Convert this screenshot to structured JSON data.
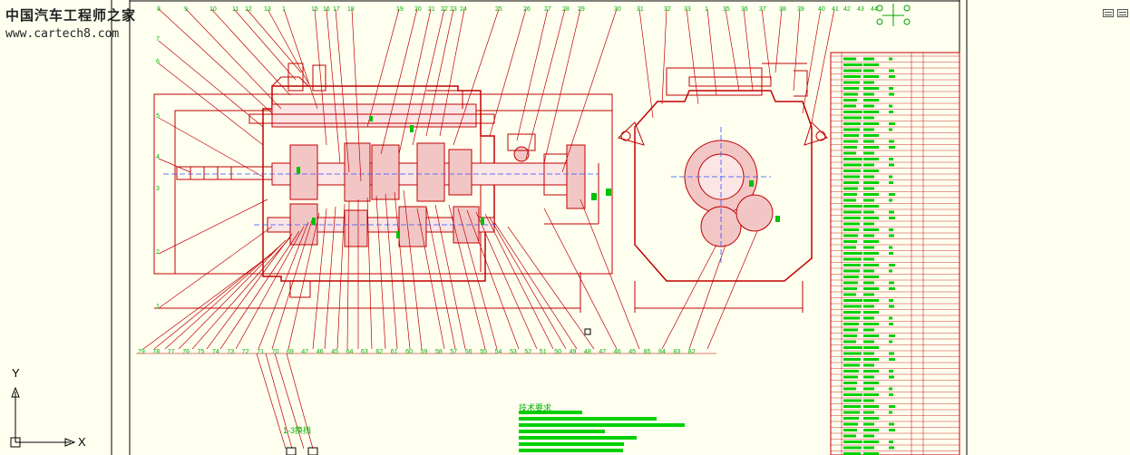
{
  "watermark": {
    "title": "中国汽车工程师之家",
    "url": "www.cartech8.com"
  },
  "axes": {
    "y": "Y",
    "x": "X"
  },
  "notes": {
    "subassembly": "1-3换挡",
    "tech_req": "技术要求"
  },
  "callouts_top": [
    "8",
    "9",
    "10",
    "11",
    "12",
    "13",
    "1",
    "15",
    "16",
    "17",
    "18",
    "19",
    "20",
    "21",
    "22",
    "23",
    "24",
    "25",
    "26",
    "27",
    "28",
    "29",
    "30",
    "31",
    "32",
    "33",
    "1",
    "35",
    "36",
    "37",
    "38",
    "39",
    "40",
    "41",
    "42",
    "43",
    "44"
  ],
  "callouts_bottom": [
    "79",
    "78",
    "77",
    "76",
    "75",
    "74",
    "73",
    "72",
    "71",
    "70",
    "69",
    "47",
    "46",
    "45",
    "64",
    "63",
    "62",
    "61",
    "60",
    "59",
    "58",
    "57",
    "56",
    "55",
    "54",
    "53",
    "52",
    "51",
    "50",
    "49",
    "48",
    "47",
    "46",
    "45",
    "85",
    "84",
    "83",
    "82"
  ],
  "callouts_left": [
    "7",
    "6",
    "5",
    "4",
    "3",
    "2",
    "1"
  ],
  "colors": {
    "bg": "#fffff0",
    "drawing": "#c00000",
    "annotation": "#00c000",
    "frame": "#000000"
  }
}
